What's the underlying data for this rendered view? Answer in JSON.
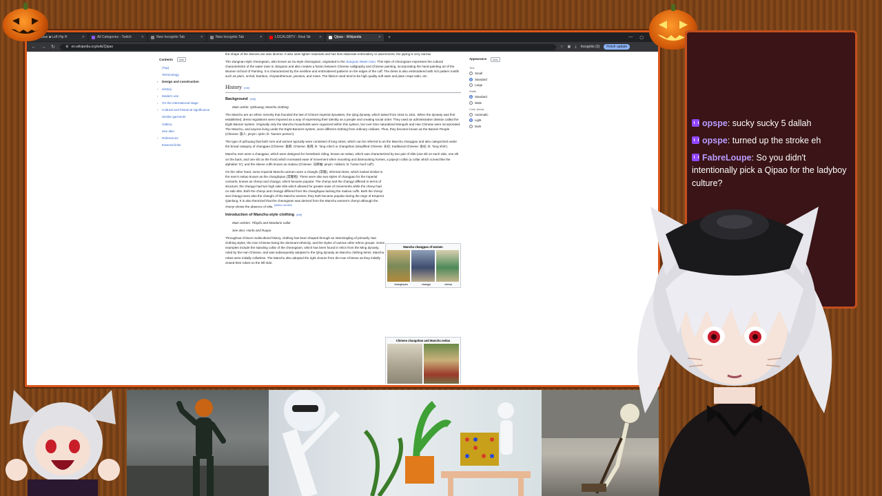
{
  "browser": {
    "tabs": [
      {
        "label": "House ■ Left Hip H"
      },
      {
        "label": "All Categories - Twitch"
      },
      {
        "label": "New Incognito Tab"
      },
      {
        "label": "New Incognito Tab"
      },
      {
        "label": "LOCALSBTV - Real Str"
      },
      {
        "label": "Qipao - Wikipedia"
      }
    ],
    "url": "en.wikipedia.org/wiki/Qipao",
    "incognito_label": "Incognito (3)",
    "finish_update": "Finish update"
  },
  "toc": {
    "title": "Contents",
    "hide": "hide",
    "items": [
      "(Top)",
      "Terminology",
      "Design and construction",
      "History",
      "Modern use",
      "On the international stage",
      "Cultural and historical significance",
      "Similar garments",
      "Gallery",
      "See also",
      "References",
      "External links"
    ]
  },
  "article": {
    "p0": "the shape of the sleeves are also diverse. It also uses lighter materials and has less elaborate embroidery or adornments; the piping is very narrow.",
    "p1_a": "The Jiangnan-style cheongsam, also known as Su-style cheongsam, originated in the ",
    "p1_link": "Jiangnan Water town",
    "p1_b": ". This style of cheongsam expresses the cultural characteristics of the water town in Jiangnan and also creates a fusion between Chinese calligraphy and Chinese painting, incorporating the hand-painting art of the Wumen School of Painting. It is characterized by the neckline and embroidered patterns on the edges of the cuff. The dress is also embroidered with rich pattern motifs such as plum, orchid, bamboo, chrysanthemum, peonies, and roses. The fabrics used tend to be high quality soft satin and plain crepe satin, etc.",
    "h_history": "History",
    "edit": "edit",
    "h_background": "Background",
    "main_article_1": "Main article: Qizhuang; Manchu clothing",
    "p2": "The Manchu are an ethnic minority that founded the last of China's imperial dynasties, the Qing dynasty, which lasted from 1644 to 1911. When the dynasty was first established, dress regulations were imposed as a way of expressing their identity as a people and creating social order. They used an administrative division called the Eight Banner system. Originally only the Manchu households were organized within this system, but over time naturalized Mongols and Han Chinese were incorporated. The Manchu, and anyone living under the Eight Banners system, wore different clothing from ordinary civilians. Thus, they became known as the Banner People (Chinese: 旗人; pinyin: qírén; lit. 'banner person').",
    "p3": "The type of qizhuang that both men and women typically wore consisted of long robes, which can be referred to as the Manchu changpao and also categorized under the broad category of changpao (Chinese: 長袍; Chinese: 長袍; lit. 'long robe') or changshan (simplified Chinese: 长衫; traditional Chinese: 長衫; lit. 'long shirt').",
    "p4": "Manchu men wore a changpao, which were designed for horseback riding, known as neitao, which was characterized by two pair of slits (one slit on each side, one slit on the back, and one slit on the front) which increased ease of movement when mounting and dismounting horses, a pipa-jin collar (a collar which curved like the alphabet 'S'), and the sleeve cuffs known as matixiu (Chinese: 马蹄袖; pinyin: mǎtíxiù; lit. 'horse hoof cuff').",
    "p5": "On the other hand, some imperial Manchu women wore a changfu (常服), informal dress, which looked similar to the men's neitao known as the changfupao (常服袍). There were also two styles of changpao for the imperial consorts, known as chenyi and changyi, which became popular. The chenyi and the changyi differed in terms of structure; the changyi had two high side slits which allowed for greater ease of movements while the chenyi had no side slits. Both the chenyi and changyi differed from the changfupao lacking the matixiu cuffs. Both the chenyi and changyi were also the changfu of the Manchu women; they both became popular during the reign of Emperor Qianlong. It is also theorized that the cheongsam was derived from the Manchu women's chenyi although the chenyi shows the absence of slits.",
    "citation_needed": "[citation needed]",
    "h_intro": "Introduction of Manchu-style clothing",
    "main_article_2": "Main articles: Tifayifu and Mandarin collar",
    "see_also": "See also: Hanfu and Ruqun",
    "p6": "Throughout China's multicultural history, clothing has been shaped through an intermingling of primarily Han clothing styles, the Han Chinese being the dominant ethnicity, and the styles of various other ethnic groups. Some examples include the standing collar of the cheongsam, which has been found in relics from the Ming dynasty, ruled by the Han Chinese, and was subsequently adopted in the Qing dynasty as Manchu clothing items. Manchu robes were initially collarless. The Manchu also adopted the right closure from the Han Chinese as they initially closed their robes on the left side."
  },
  "figure1": {
    "title": "Manchu changpao of women",
    "captions": [
      "changfupao",
      "changyi",
      "chenyi"
    ]
  },
  "figure2": {
    "title": "Chinese changshan and Manchu neitao"
  },
  "appearance": {
    "title": "Appearance",
    "hide": "hide",
    "text_label": "Text",
    "text_options": [
      "Small",
      "Standard",
      "Large"
    ],
    "width_label": "Width",
    "width_options": [
      "Standard",
      "Wide"
    ],
    "color_label": "Color (beta)",
    "color_options": [
      "Automatic",
      "Light",
      "Dark"
    ]
  },
  "chat": [
    {
      "user": "opspe",
      "text": "sucky sucky 5 dallah"
    },
    {
      "user": "opspe",
      "text": "turned up the stroke eh"
    },
    {
      "user": "FabreLoupe",
      "text": "So you didn't intentionally pick a Qipao for the ladyboy culture?"
    }
  ],
  "colors": {
    "frame_orange": "#d8571a",
    "chat_bg": "#3a1416",
    "link": "#3366cc",
    "twitch_purple": "#9146ff"
  }
}
